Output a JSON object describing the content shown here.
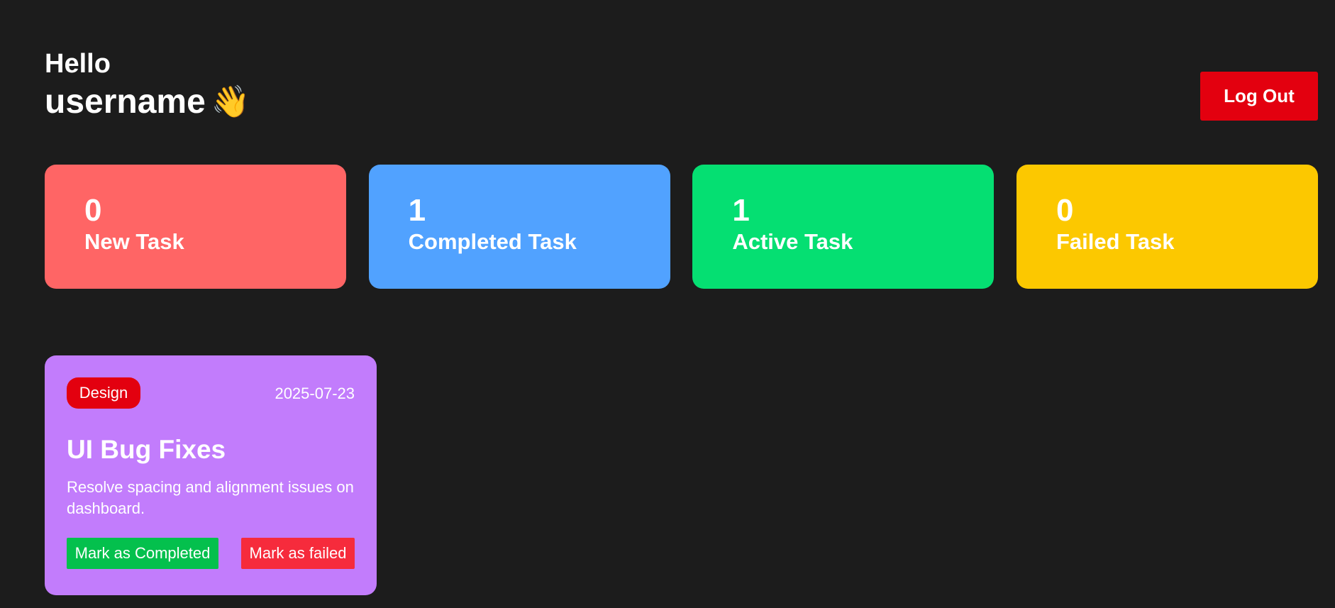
{
  "header": {
    "greeting": "Hello",
    "username": "username",
    "wave_emoji": "👋",
    "logout_label": "Log Out"
  },
  "stats": [
    {
      "count": "0",
      "label": "New Task",
      "color": "#ff6565"
    },
    {
      "count": "1",
      "label": "Completed Task",
      "color": "#51a2ff"
    },
    {
      "count": "1",
      "label": "Active Task",
      "color": "#05df72"
    },
    {
      "count": "0",
      "label": "Failed Task",
      "color": "#fcc800"
    }
  ],
  "tasks": [
    {
      "category": "Design",
      "date": "2025-07-23",
      "title": "UI Bug Fixes",
      "description": "Resolve spacing and alignment issues on dashboard.",
      "complete_label": "Mark as Completed",
      "failed_label": "Mark as failed",
      "color": "#c27cfc"
    }
  ],
  "colors": {
    "background": "#1c1c1c",
    "logout": "#e3000f",
    "tag": "#e3000f",
    "complete_button": "#04c04d",
    "failed_button": "#f62b3c"
  }
}
